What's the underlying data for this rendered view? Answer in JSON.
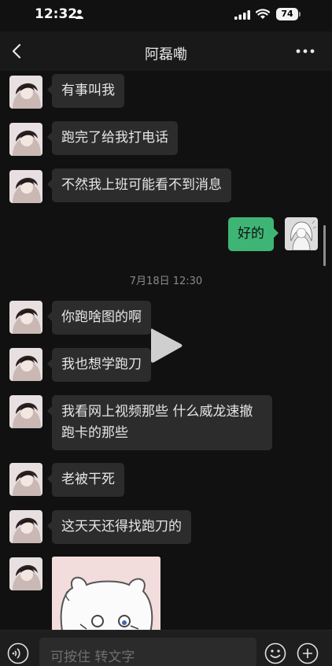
{
  "status_bar": {
    "time": "12:32",
    "battery": "74"
  },
  "nav": {
    "title": "阿磊嘞"
  },
  "messages": [
    {
      "text": "有事叫我"
    },
    {
      "text": "跑完了给我打电话"
    },
    {
      "text": "不然我上班可能看不到消息"
    },
    {
      "text": "好的"
    },
    {
      "text": "你跑啥图的啊"
    },
    {
      "text": "我也想学跑刀"
    },
    {
      "text": "我看网上视频那些 什么威龙速撤\n跑卡的那些"
    },
    {
      "text": "老被干死"
    },
    {
      "text": "这天天还得找跑刀的"
    }
  ],
  "timestamp": "7月18日 12:30",
  "input": {
    "placeholder": "可按住 转文字"
  },
  "colors": {
    "bubble_in": "#2c2c2c",
    "bubble_out": "#3eb575",
    "background": "#111111"
  }
}
